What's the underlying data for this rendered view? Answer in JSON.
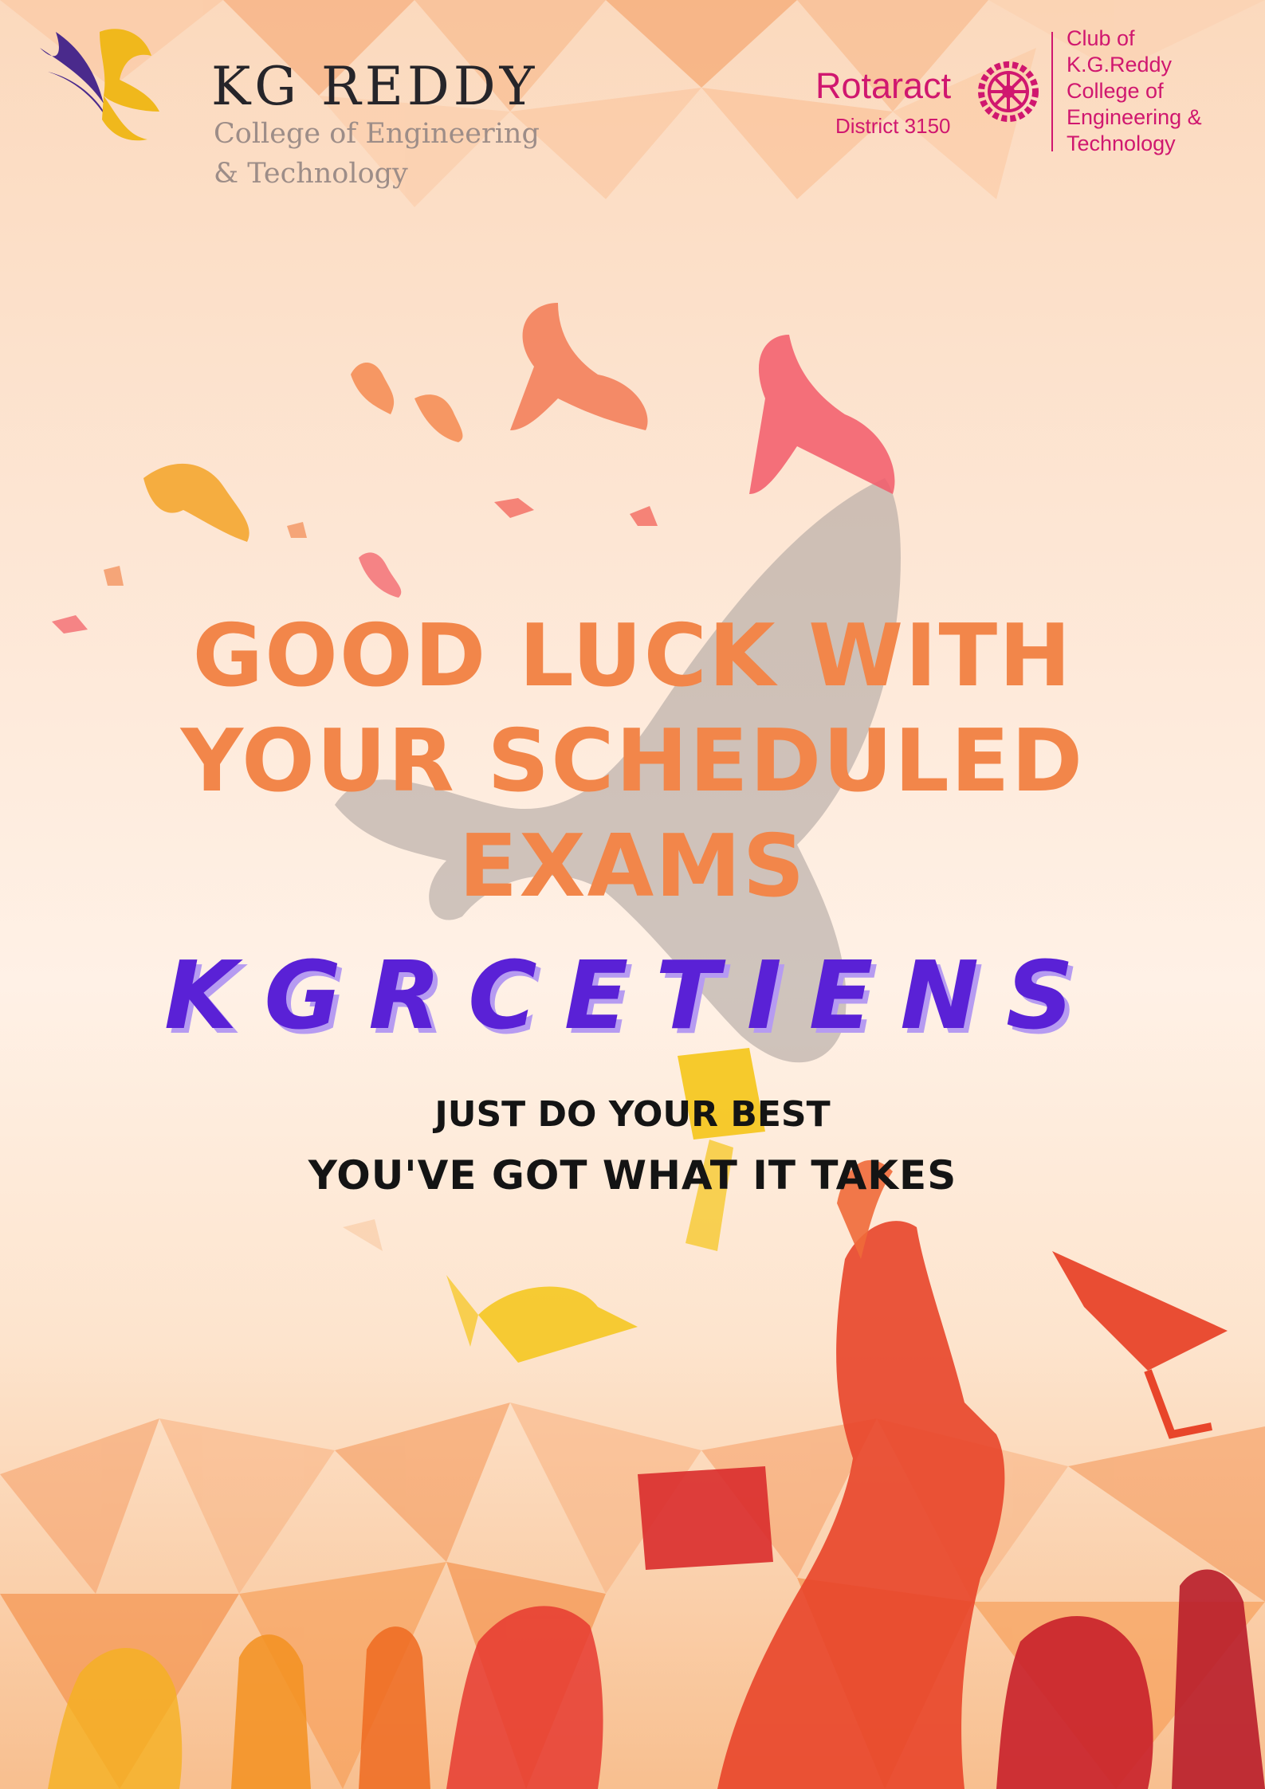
{
  "institution": {
    "name": "KG REDDY",
    "subtitle_line1": "College of Engineering",
    "subtitle_line2": "& Technology",
    "logo_icon": "eagle-icon"
  },
  "rotaract": {
    "name": "Rotaract",
    "district": "District 3150",
    "club_lines": [
      "Club of",
      "K.G.Reddy",
      "College of",
      "Engineering &",
      "Technology"
    ],
    "logo_icon": "rotary-wheel-icon"
  },
  "headline": {
    "lines": [
      "GOOD LUCK WITH",
      "YOUR SCHEDULED",
      "EXAMS"
    ]
  },
  "brand": "KGRCETIENS",
  "subline1": "JUST DO YOUR BEST",
  "subline2": "YOU'VE GOT WHAT IT TAKES",
  "colors": {
    "headline": "#f2864a",
    "brand": "#5a21d6",
    "brand_shadow": "#b69bf1",
    "rotaract": "#d0176f",
    "text": "#141414",
    "eagle_purple": "#4a2a8c",
    "eagle_gold": "#f0b81c"
  }
}
